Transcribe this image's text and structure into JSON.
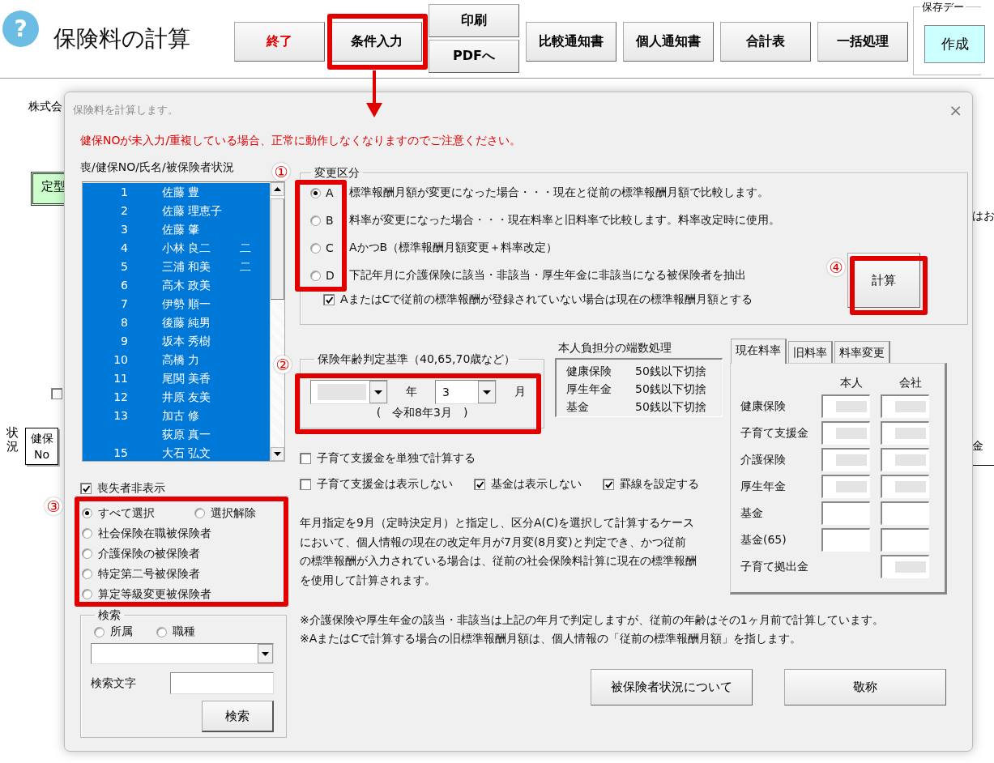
{
  "app": {
    "help_icon": "?",
    "title": "保険料の計算"
  },
  "toolbar": {
    "buttons": [
      {
        "kind": "danger",
        "label": "終了"
      },
      {
        "kind": "normal",
        "label": "条件入力"
      },
      {
        "kind": "stacked",
        "labels": [
          "印刷",
          "PDFへ"
        ]
      },
      {
        "kind": "normal",
        "label": "比較通知書"
      },
      {
        "kind": "normal",
        "label": "個人通知書"
      },
      {
        "kind": "normal",
        "label": "合計表"
      },
      {
        "kind": "normal",
        "label": "一括処理"
      }
    ],
    "save_group": {
      "title": "保存デー",
      "button": "作成"
    }
  },
  "sheet": {
    "company": "株式会",
    "template_button": "定型",
    "right_text": "はお",
    "right_text_2": "金",
    "checkbox": {
      "checked": false
    },
    "status_label": "状況",
    "header_cell": "健保 No"
  },
  "dialog": {
    "title": "保険料を計算します。",
    "close": "×",
    "warning": "健保NOが未入力/重複している場合、正常に動作しなくなりますのでご注意ください。",
    "insured_list": {
      "header": "喪/健保NO/氏名/被保険者状況",
      "rows": [
        {
          "no": "1",
          "name": "佐藤 豊",
          "status": "",
          "selected": true
        },
        {
          "no": "2",
          "name": "佐藤 理恵子",
          "status": "",
          "selected": true
        },
        {
          "no": "3",
          "name": "佐藤 肇",
          "status": "",
          "selected": true
        },
        {
          "no": "4",
          "name": "小林 良二",
          "status": "二",
          "selected": true
        },
        {
          "no": "5",
          "name": "三浦 和美",
          "status": "二",
          "selected": true
        },
        {
          "no": "6",
          "name": "高木 政美",
          "status": "",
          "selected": true
        },
        {
          "no": "7",
          "name": "伊勢 順一",
          "status": "",
          "selected": true
        },
        {
          "no": "8",
          "name": "後藤 純男",
          "status": "",
          "selected": true
        },
        {
          "no": "9",
          "name": "坂本 秀樹",
          "status": "",
          "selected": true
        },
        {
          "no": "10",
          "name": "高橋 力",
          "status": "",
          "selected": true
        },
        {
          "no": "11",
          "name": "尾関 美香",
          "status": "",
          "selected": true
        },
        {
          "no": "12",
          "name": "井原 友美",
          "status": "",
          "selected": true
        },
        {
          "no": "13",
          "name": "加古 修",
          "status": "",
          "selected": true
        },
        {
          "no": "",
          "name": "荻原 真一",
          "status": "",
          "selected": true
        },
        {
          "no": "15",
          "name": "大石 弘文",
          "status": "",
          "selected": true
        }
      ]
    },
    "hide_lost": {
      "label": "喪失者非表示",
      "checked": true
    },
    "filter_options": [
      {
        "label": "すべて選択",
        "selected": true
      },
      {
        "label": "選択解除",
        "selected": false
      },
      {
        "label": "社会保険在職被保険者",
        "selected": false
      },
      {
        "label": "介護保険の被保険者",
        "selected": false
      },
      {
        "label": "特定第二号被保険者",
        "selected": false
      },
      {
        "label": "算定等級変更被保険者",
        "selected": false
      }
    ],
    "search": {
      "title": "検索",
      "options": [
        {
          "label": "所属",
          "selected": false
        },
        {
          "label": "職種",
          "selected": false
        }
      ],
      "text_label": "検索文字",
      "button": "検索"
    },
    "change_type": {
      "title": "変更区分",
      "options": [
        {
          "letter": "A",
          "text": "標準報酬月額が変更になった場合・・・現在と従前の標準報酬月額で比較します。",
          "selected": true
        },
        {
          "letter": "B",
          "text": "料率が変更になった場合・・・現在料率と旧料率で比較します。料率改定時に使用。",
          "selected": false
        },
        {
          "letter": "C",
          "text": "AかつB（標準報酬月額変更＋料率改定）",
          "selected": false
        },
        {
          "letter": "D",
          "text": "下記年月に介護保険に該当・非該当・厚生年金に非該当になる被保険者を抽出",
          "selected": false
        }
      ],
      "fallback": {
        "label": "AまたはCで従前の標準報酬が登録されていない場合は現在の標準報酬月額とする",
        "checked": true
      },
      "calc_button": "計算"
    },
    "age_basis": {
      "title": "保険年齢判定基準（40,65,70歳など）",
      "year": {
        "blurred": true
      },
      "year_unit": "年",
      "month": {
        "value": "3"
      },
      "month_unit": "月",
      "era": "(　令和8年3月　)"
    },
    "rounding": {
      "title": "本人負担分の端数処理",
      "rows": [
        {
          "item": "健康保険",
          "rule": "50銭以下切捨"
        },
        {
          "item": "厚生年金",
          "rule": "50銭以下切捨"
        },
        {
          "item": "基金",
          "rule": "50銭以下切捨"
        }
      ]
    },
    "options": [
      {
        "label": "子育て支援金を単独で計算する",
        "checked": false
      },
      {
        "label": "子育て支援金は表示しない",
        "checked": false
      },
      {
        "label": "基金は表示しない",
        "checked": true
      },
      {
        "label": "罫線を設定する",
        "checked": true
      }
    ],
    "note": "年月指定を9月（定時決定月）と指定し、区分A(C)を選択して計算するケースにおいて、個人情報の現在の改定年月が7月変(8月変)と判定でき、かつ従前の標準報酬が入力されている場合は、従前の社会保険料計算に現在の標準報酬を使用して計算されます。",
    "rates": {
      "tabs": [
        {
          "label": "現在料率",
          "selected": true
        },
        {
          "label": "旧料率",
          "selected": false
        },
        {
          "label": "料率変更",
          "selected": false
        }
      ],
      "columns": [
        "本人",
        "会社"
      ],
      "rows": [
        {
          "label": "健康保険",
          "fields": [
            {
              "blurred": true
            },
            {
              "blurred": true
            }
          ]
        },
        {
          "label": "子育て支援金",
          "fields": [
            {
              "blurred": true
            },
            {
              "blurred": true
            }
          ]
        },
        {
          "label": "介護保険",
          "fields": [
            {
              "blurred": true
            },
            {
              "blurred": true
            }
          ]
        },
        {
          "label": "厚生年金",
          "fields": [
            {
              "blurred": true
            },
            {
              "blurred": true
            }
          ]
        },
        {
          "label": "基金",
          "fields": [
            {
              "blurred": false
            },
            {
              "blurred": false
            }
          ]
        },
        {
          "label": "基金(65)",
          "fields": [
            {
              "blurred": false
            },
            {
              "blurred": false
            }
          ]
        },
        {
          "label": "子育て拠出金",
          "fields": [
            {
              "blurred": true
            }
          ]
        }
      ]
    },
    "footnotes": [
      "※介護保険や厚生年金の該当・非該当は上記の年月で判定しますが、従前の年齢はその1ヶ月前で計算しています。",
      "※AまたはCで計算する場合の旧標準報酬月額は、個人情報の「従前の標準報酬月額」を指します。"
    ],
    "buttons": [
      "被保険者状況について",
      "敬称"
    ]
  },
  "annotations": [
    {
      "label": "①"
    },
    {
      "label": "②"
    },
    {
      "label": "③"
    },
    {
      "label": "④"
    }
  ]
}
